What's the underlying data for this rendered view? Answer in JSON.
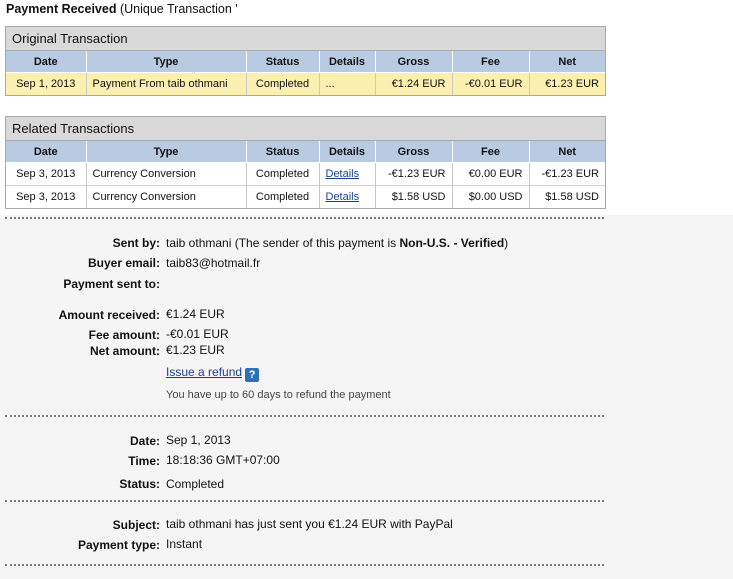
{
  "header": {
    "title": "Payment Received",
    "subtitle": "(Unique Transaction '"
  },
  "original": {
    "title": "Original Transaction",
    "columns": [
      "Date",
      "Type",
      "Status",
      "Details",
      "Gross",
      "Fee",
      "Net"
    ],
    "row": {
      "date": "Sep 1, 2013",
      "type": "Payment From taib othmani",
      "status": "Completed",
      "details": "...",
      "gross": "€1.24 EUR",
      "fee": "-€0.01 EUR",
      "net": "€1.23 EUR"
    }
  },
  "related": {
    "title": "Related Transactions",
    "columns": [
      "Date",
      "Type",
      "Status",
      "Details",
      "Gross",
      "Fee",
      "Net"
    ],
    "rows": [
      {
        "date": "Sep 3, 2013",
        "type": "Currency Conversion",
        "status": "Completed",
        "details": "Details",
        "gross": "-€1.23 EUR",
        "fee": "€0.00 EUR",
        "net": "-€1.23 EUR"
      },
      {
        "date": "Sep 3, 2013",
        "type": "Currency Conversion",
        "status": "Completed",
        "details": "Details",
        "gross": "$1.58 USD",
        "fee": "$0.00 USD",
        "net": "$1.58 USD"
      }
    ]
  },
  "sender": {
    "sent_by_label": "Sent by:",
    "sent_by_name": "taib othmani",
    "sent_by_prefix": "(The sender of this payment is",
    "sent_by_status": "Non-U.S. - Verified",
    "sent_by_suffix": ")",
    "buyer_email_label": "Buyer email:",
    "buyer_email": "taib83@hotmail.fr",
    "payment_sent_to_label": "Payment sent to:"
  },
  "amounts": {
    "amount_received_label": "Amount received:",
    "amount_received": "€1.24 EUR",
    "fee_amount_label": "Fee amount:",
    "fee_amount": "-€0.01 EUR",
    "net_amount_label": "Net amount:",
    "net_amount": "€1.23 EUR",
    "refund_link": "Issue a refund",
    "refund_help": "?",
    "refund_note": "You have up to 60 days to refund the payment"
  },
  "timing": {
    "date_label": "Date:",
    "date": "Sep 1, 2013",
    "time_label": "Time:",
    "time": "18:18:36 GMT+07:00",
    "status_label": "Status:",
    "status": "Completed"
  },
  "message": {
    "subject_label": "Subject:",
    "subject": "taib othmani has just sent you €1.24 EUR with PayPal",
    "payment_type_label": "Payment type:",
    "payment_type": "Instant"
  }
}
